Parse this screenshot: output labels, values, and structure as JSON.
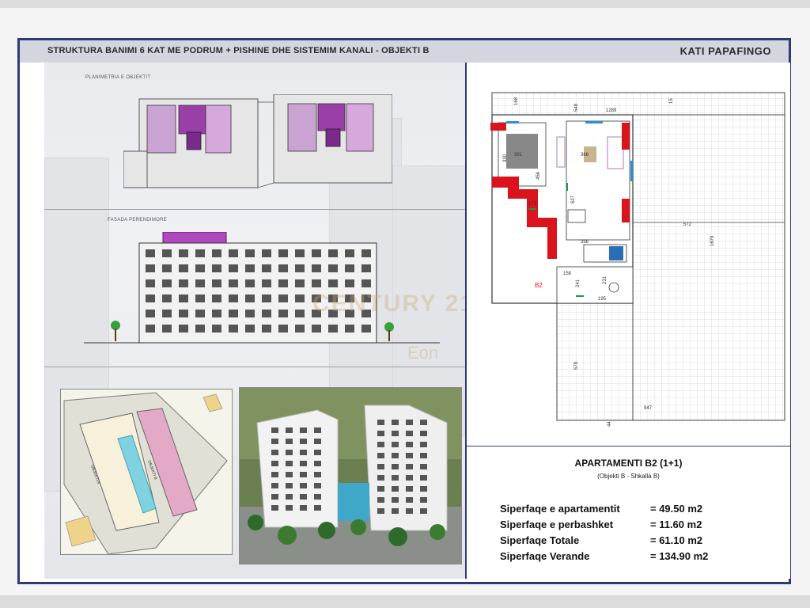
{
  "header": {
    "title": "STRUKTURA BANIMI 6 KAT ME PODRUM + PISHINE DHE SISTEMIM KANALI   -  OBJEKTI B",
    "floor": "KATI PAPAFINGO"
  },
  "left": {
    "plan_label": "PLANIMETRIA E OBJEKTIT",
    "facade_label": "FASADA PERENDIMORE",
    "site_label_a": "OBJEKTI A",
    "site_label_b": "OBJEKTI B"
  },
  "watermark": {
    "brand": "CENTURY 21",
    "sub": "Eon"
  },
  "plan": {
    "unit_label": "B2",
    "dims": [
      "168",
      "548",
      "1289",
      "301",
      "330",
      "456",
      "366",
      "627",
      "173",
      "572",
      "356",
      "1679",
      "158",
      "241",
      "231",
      "195",
      "578",
      "947",
      "44",
      "15"
    ]
  },
  "apartment": {
    "title": "APARTAMENTI B2 (1+1)",
    "subtitle": "(Objekti B - Shkalla B)",
    "areas": [
      {
        "label": "Siperfaqe e apartamentit",
        "value": "= 49.50 m2"
      },
      {
        "label": "Siperfaqe e perbashket",
        "value": "= 11.60 m2"
      },
      {
        "label": "Siperfaqe Totale",
        "value": "= 61.10 m2"
      },
      {
        "label": "Siperfaqe Verande",
        "value": "= 134.90 m2"
      }
    ]
  },
  "colors": {
    "frame": "#2e3a78",
    "wall_red": "#d9141c",
    "plan_purple": "#9b3fa8"
  }
}
